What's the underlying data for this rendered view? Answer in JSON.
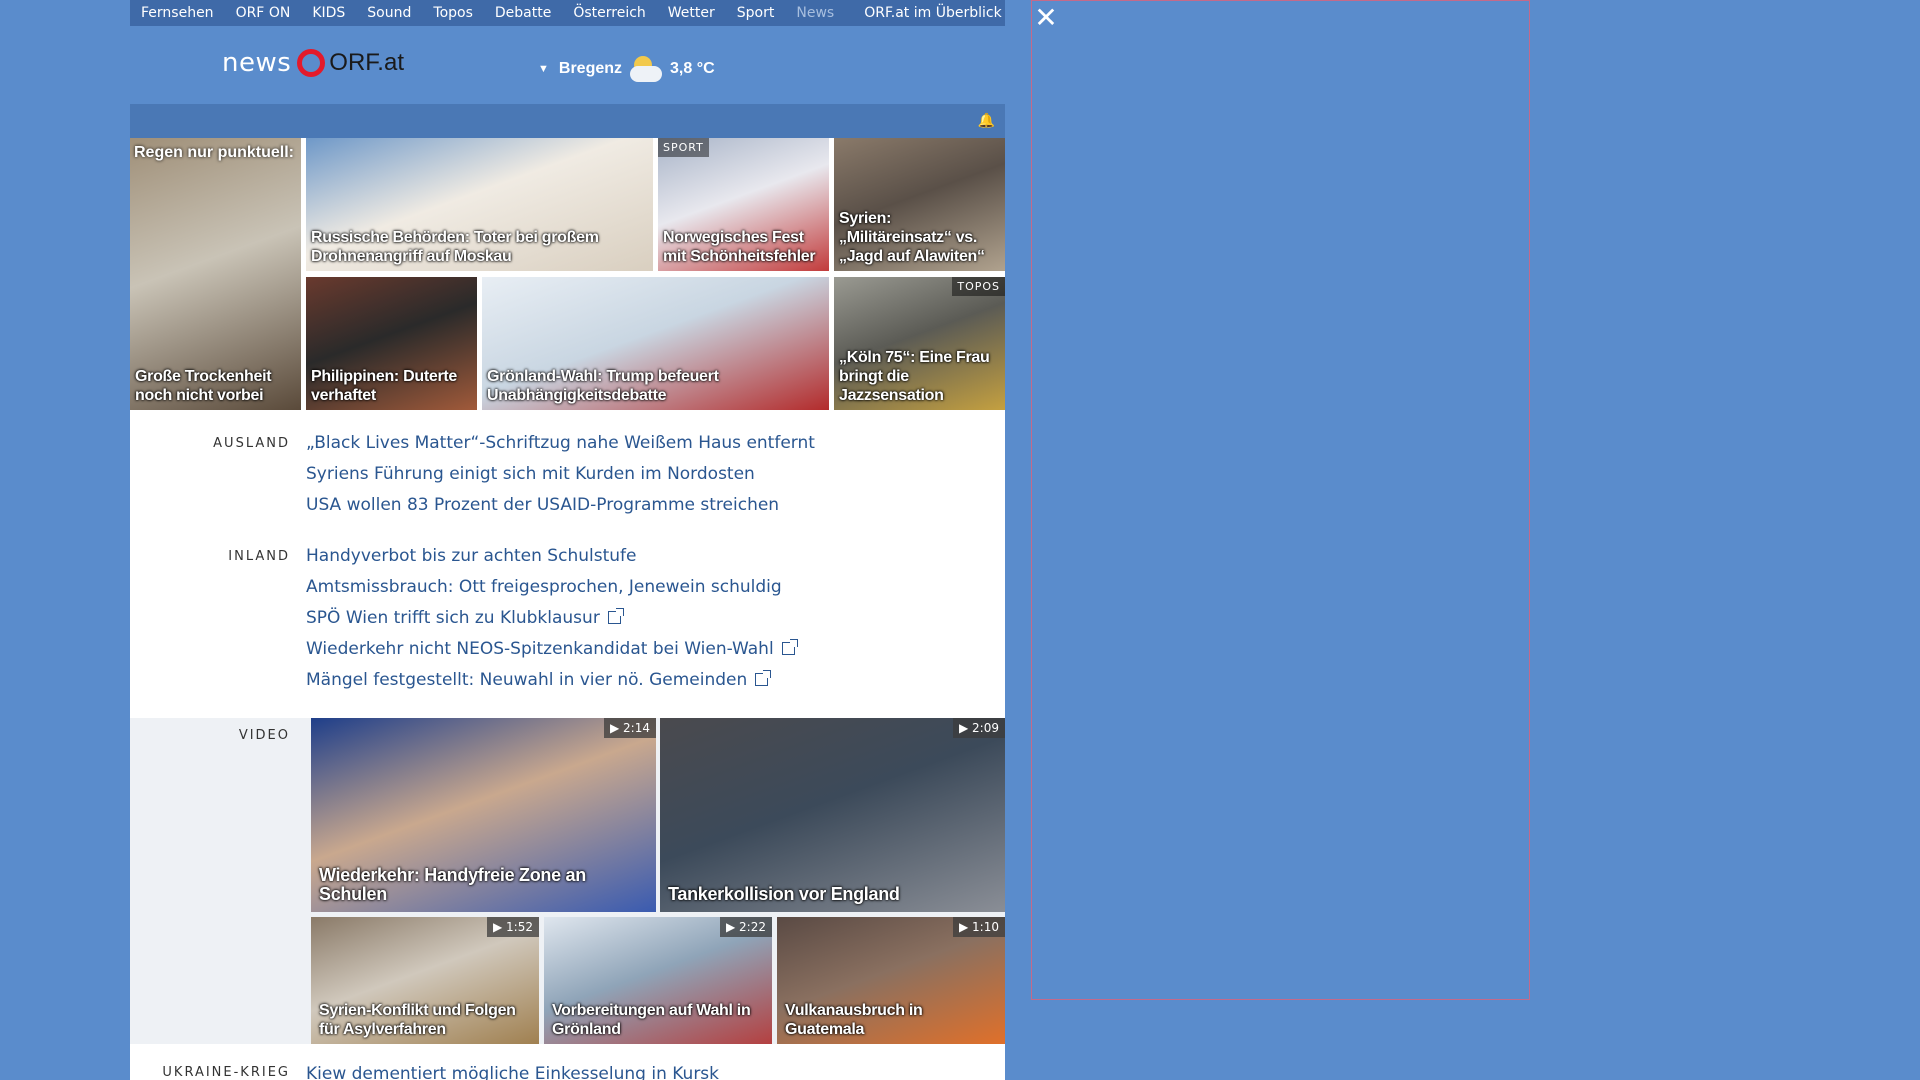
{
  "nav": {
    "items": [
      "Fernsehen",
      "ORF ON",
      "KIDS",
      "Sound",
      "Topos",
      "Debatte",
      "Österreich",
      "Wetter",
      "Sport",
      "News"
    ],
    "overview": "ORF.at im Überblick"
  },
  "header": {
    "logo_news": "news",
    "logo_orf": "ORF.at",
    "weather": {
      "location": "Bregenz",
      "temp": "3,8 °C"
    }
  },
  "tiles": [
    {
      "caption_top": "Regen nur punktuell:",
      "caption": "Große Trockenheit noch nicht vorbei",
      "colors": [
        "#9f8f78",
        "#5a4a3a",
        "#c9c3b6"
      ]
    },
    {
      "caption": "Russische Behörden: Toter bei großem Drohnenangriff auf Moskau",
      "colors": [
        "#6e98c8",
        "#d9cfc0",
        "#f0ebe3"
      ]
    },
    {
      "tag": "SPORT",
      "caption": "Norwegisches Fest mit Schönheitsfehler",
      "colors": [
        "#a8b4c8",
        "#c23b3b",
        "#e8e8ee"
      ]
    },
    {
      "caption": "Syrien: „Militäreinsatz“ vs. „Jagd auf Alawiten“",
      "colors": [
        "#8a7a6a",
        "#b0a28e",
        "#5a5048"
      ]
    },
    {
      "caption": "Philippinen: Duterte verhaftet",
      "colors": [
        "#6a3a2e",
        "#a15a3a",
        "#2a2a2a"
      ]
    },
    {
      "caption": "Grönland-Wahl: Trump befeuert Unabhängigkeitsdebatte",
      "colors": [
        "#e8eef4",
        "#b32b2b",
        "#c9d6e2"
      ]
    },
    {
      "tag": "TOPOS",
      "caption": "„Köln 75“: Eine Frau bringt die Jazzsensation",
      "colors": [
        "#9a9a92",
        "#c4a040",
        "#5b5b55"
      ]
    }
  ],
  "sections": [
    {
      "label": "AUSLAND",
      "items": [
        {
          "text": "„Black Lives Matter“-Schriftzug nahe Weißem Haus entfernt",
          "external": false
        },
        {
          "text": "Syriens Führung einigt sich mit Kurden im Nordosten",
          "external": false
        },
        {
          "text": "USA wollen 83 Prozent der USAID-Programme streichen",
          "external": false
        }
      ]
    },
    {
      "label": "INLAND",
      "items": [
        {
          "text": "Handyverbot bis zur achten Schulstufe",
          "external": false
        },
        {
          "text": "Amtsmissbrauch: Ott freigesprochen, Jenewein schuldig",
          "external": false
        },
        {
          "text": "SPÖ Wien trifft sich zu Klubklausur",
          "external": true
        },
        {
          "text": "Wiederkehr nicht NEOS-Spitzenkandidat bei Wien-Wahl",
          "external": true
        },
        {
          "text": "Mängel festgestellt: Neuwahl in vier nö. Gemeinden",
          "external": true
        }
      ]
    }
  ],
  "video": {
    "label": "VIDEO",
    "items": [
      {
        "caption": "Wiederkehr: Handyfreie Zone an Schulen",
        "duration": "2:14",
        "colors": [
          "#1e3e8a",
          "#3a5bb0",
          "#c9a88e"
        ]
      },
      {
        "caption": "Tankerkollision vor England",
        "duration": "2:09",
        "colors": [
          "#4a4a4e",
          "#8a8e96",
          "#3c4a5a"
        ]
      },
      {
        "caption": "Syrien-Konflikt und Folgen für Asylverfahren",
        "duration": "1:52",
        "colors": [
          "#8a7a68",
          "#a08050",
          "#d0c8bc"
        ]
      },
      {
        "caption": "Vorbereitungen auf Wahl in Grönland",
        "duration": "2:22",
        "colors": [
          "#dfe6ee",
          "#b44040",
          "#8fa4b8"
        ]
      },
      {
        "caption": "Vulkanausbruch in Guatemala",
        "duration": "1:10",
        "colors": [
          "#5a4a44",
          "#e0702a",
          "#8a7060"
        ]
      }
    ]
  },
  "bottom": {
    "label": "UKRAINE-KRIEG",
    "text": "Kiew dementiert mögliche Einkesselung in Kursk"
  }
}
